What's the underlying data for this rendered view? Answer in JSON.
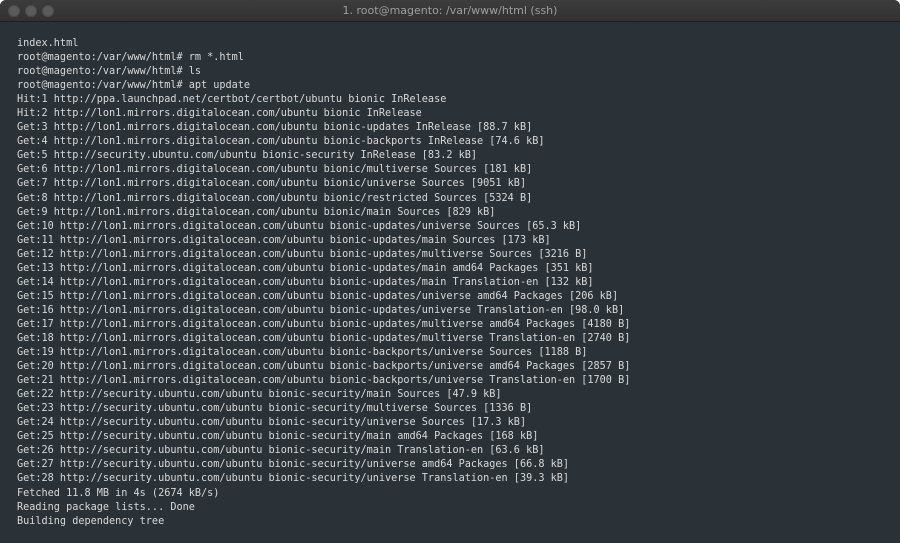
{
  "window": {
    "title": "1. root@magento: /var/www/html (ssh)"
  },
  "terminal": {
    "lines": [
      "index.html",
      "root@magento:/var/www/html# rm *.html",
      "root@magento:/var/www/html# ls",
      "root@magento:/var/www/html# apt update",
      "Hit:1 http://ppa.launchpad.net/certbot/certbot/ubuntu bionic InRelease",
      "Hit:2 http://lon1.mirrors.digitalocean.com/ubuntu bionic InRelease",
      "Get:3 http://lon1.mirrors.digitalocean.com/ubuntu bionic-updates InRelease [88.7 kB]",
      "Get:4 http://lon1.mirrors.digitalocean.com/ubuntu bionic-backports InRelease [74.6 kB]",
      "Get:5 http://security.ubuntu.com/ubuntu bionic-security InRelease [83.2 kB]",
      "Get:6 http://lon1.mirrors.digitalocean.com/ubuntu bionic/multiverse Sources [181 kB]",
      "Get:7 http://lon1.mirrors.digitalocean.com/ubuntu bionic/universe Sources [9051 kB]",
      "Get:8 http://lon1.mirrors.digitalocean.com/ubuntu bionic/restricted Sources [5324 B]",
      "Get:9 http://lon1.mirrors.digitalocean.com/ubuntu bionic/main Sources [829 kB]",
      "Get:10 http://lon1.mirrors.digitalocean.com/ubuntu bionic-updates/universe Sources [65.3 kB]",
      "Get:11 http://lon1.mirrors.digitalocean.com/ubuntu bionic-updates/main Sources [173 kB]",
      "Get:12 http://lon1.mirrors.digitalocean.com/ubuntu bionic-updates/multiverse Sources [3216 B]",
      "Get:13 http://lon1.mirrors.digitalocean.com/ubuntu bionic-updates/main amd64 Packages [351 kB]",
      "Get:14 http://lon1.mirrors.digitalocean.com/ubuntu bionic-updates/main Translation-en [132 kB]",
      "Get:15 http://lon1.mirrors.digitalocean.com/ubuntu bionic-updates/universe amd64 Packages [206 kB]",
      "Get:16 http://lon1.mirrors.digitalocean.com/ubuntu bionic-updates/universe Translation-en [98.0 kB]",
      "Get:17 http://lon1.mirrors.digitalocean.com/ubuntu bionic-updates/multiverse amd64 Packages [4180 B]",
      "Get:18 http://lon1.mirrors.digitalocean.com/ubuntu bionic-updates/multiverse Translation-en [2740 B]",
      "Get:19 http://lon1.mirrors.digitalocean.com/ubuntu bionic-backports/universe Sources [1188 B]",
      "Get:20 http://lon1.mirrors.digitalocean.com/ubuntu bionic-backports/universe amd64 Packages [2857 B]",
      "Get:21 http://lon1.mirrors.digitalocean.com/ubuntu bionic-backports/universe Translation-en [1700 B]",
      "Get:22 http://security.ubuntu.com/ubuntu bionic-security/main Sources [47.9 kB]",
      "Get:23 http://security.ubuntu.com/ubuntu bionic-security/multiverse Sources [1336 B]",
      "Get:24 http://security.ubuntu.com/ubuntu bionic-security/universe Sources [17.3 kB]",
      "Get:25 http://security.ubuntu.com/ubuntu bionic-security/main amd64 Packages [168 kB]",
      "Get:26 http://security.ubuntu.com/ubuntu bionic-security/main Translation-en [63.6 kB]",
      "Get:27 http://security.ubuntu.com/ubuntu bionic-security/universe amd64 Packages [66.8 kB]",
      "Get:28 http://security.ubuntu.com/ubuntu bionic-security/universe Translation-en [39.3 kB]",
      "Fetched 11.8 MB in 4s (2674 kB/s)",
      "Reading package lists... Done",
      "Building dependency tree"
    ]
  }
}
